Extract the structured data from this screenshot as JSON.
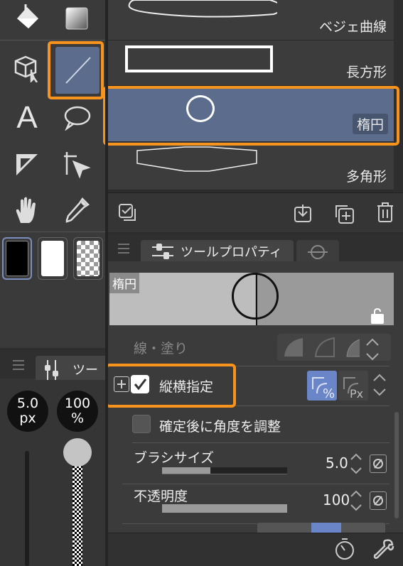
{
  "tool_list": {
    "items": [
      {
        "label": "ベジェ曲線"
      },
      {
        "label": "長方形"
      },
      {
        "label": "楕円"
      },
      {
        "label": "多角形"
      }
    ]
  },
  "panel": {
    "tab_label": "ツールプロパティ",
    "preview_label": "楕円"
  },
  "properties": {
    "line_fill_label": "線・塗り",
    "aspect_label": "縦横指定",
    "aspect_checked": true,
    "adjust_angle_label": "確定後に角度を調整",
    "brush_size_label": "ブラシサイズ",
    "brush_size_value": "5.0",
    "opacity_label": "不透明度",
    "opacity_value": "100"
  },
  "sub_tool": {
    "tab_label": "ツー",
    "size_value": "5.0",
    "size_unit": "px",
    "opacity_value": "100",
    "opacity_unit": "%"
  },
  "colors": {
    "highlight": "#f7941d",
    "selected": "#5b6c8d",
    "accent": "#6a86c9"
  },
  "icons": [
    "fill-bucket-icon",
    "gradient-icon",
    "3d-object-icon",
    "line-icon",
    "text-icon",
    "balloon-icon",
    "ruler-icon",
    "control-point-icon",
    "hand-icon",
    "eyedropper-icon"
  ]
}
